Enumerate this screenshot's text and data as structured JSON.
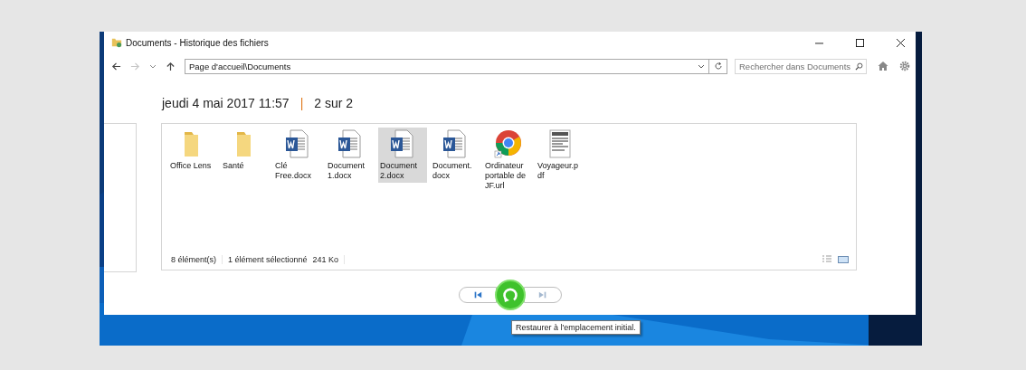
{
  "window": {
    "title": "Documents - Historique des fichiers"
  },
  "navigation": {
    "back": {
      "disabled": false
    },
    "forward": {
      "disabled": true
    }
  },
  "address": {
    "value": "Page d'accueil\\Documents"
  },
  "search": {
    "placeholder": "Rechercher dans Documents"
  },
  "snapshot": {
    "date": "jeudi 4 mai 2017 11:57",
    "separator": "|",
    "position": "2 sur 2"
  },
  "files": [
    {
      "name": "Office Lens",
      "kind": "folder",
      "selected": false
    },
    {
      "name": "Santé",
      "kind": "folder",
      "selected": false
    },
    {
      "name": "Clé Free.docx",
      "kind": "word",
      "selected": false
    },
    {
      "name": "Document 1.docx",
      "kind": "word",
      "selected": false
    },
    {
      "name": "Document 2.docx",
      "kind": "word",
      "selected": true
    },
    {
      "name": "Document. docx",
      "kind": "word",
      "selected": false
    },
    {
      "name": "Ordinateur portable de JF.url",
      "kind": "chrome",
      "selected": false
    },
    {
      "name": "Voyageur.p df",
      "kind": "pdf",
      "selected": false
    }
  ],
  "status_bar": {
    "count": "8 élément(s)",
    "selection": "1 élément sélectionné",
    "size": "241 Ko"
  },
  "playback": {
    "previous": {
      "disabled": false
    },
    "next": {
      "disabled": true
    }
  },
  "tooltip": {
    "text": "Restaurer à l'emplacement initial."
  }
}
